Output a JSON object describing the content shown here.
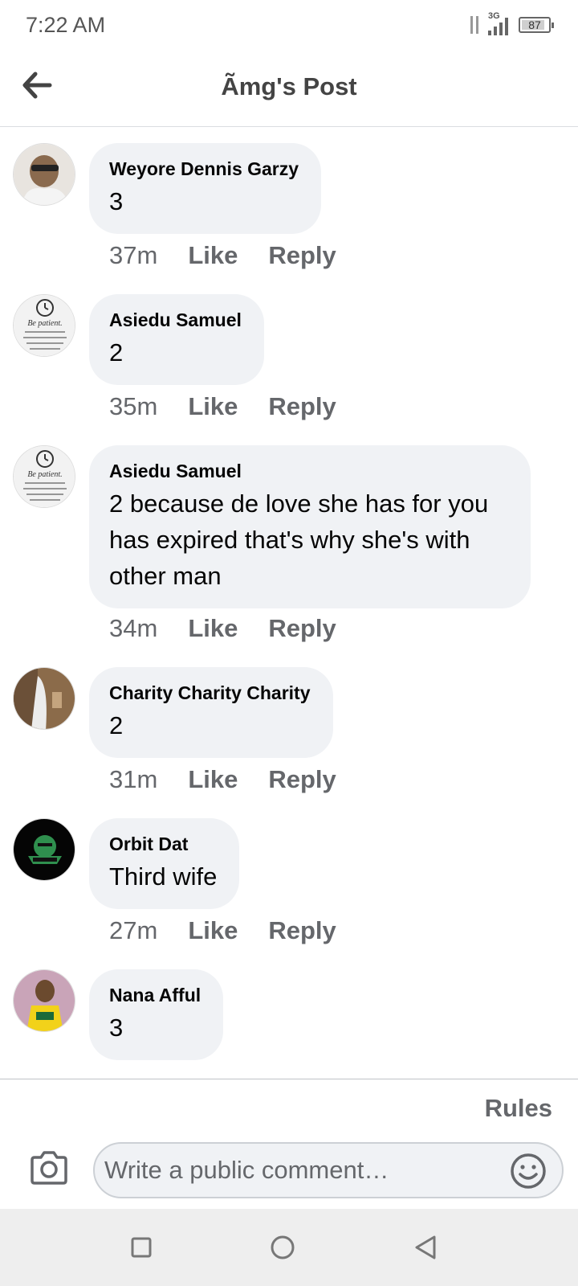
{
  "status_bar": {
    "time": "7:22 AM",
    "network": "3G",
    "battery": "87",
    "battery_level": 0.87
  },
  "header": {
    "title": "Ãmg's Post",
    "back_icon": "arrow-left-icon"
  },
  "comments": [
    {
      "author": "Weyore Dennis Garzy",
      "text": "3",
      "time": "37m",
      "like": "Like",
      "reply": "Reply"
    },
    {
      "author": "Asiedu Samuel",
      "text": "2",
      "time": "35m",
      "like": "Like",
      "reply": "Reply"
    },
    {
      "author": "Asiedu Samuel",
      "text": "2 because de love she has for you has expired that's why she's with other man",
      "time": "34m",
      "like": "Like",
      "reply": "Reply"
    },
    {
      "author": "Charity Charity Charity",
      "text": "2",
      "time": "31m",
      "like": "Like",
      "reply": "Reply"
    },
    {
      "author": "Orbit Dat",
      "text": "Third wife",
      "time": "27m",
      "like": "Like",
      "reply": "Reply"
    },
    {
      "author": "Nana Afful",
      "text": "3"
    }
  ],
  "composer": {
    "rules": "Rules",
    "placeholder": "Write a public comment…",
    "camera_icon": "camera-icon",
    "emoji_icon": "smiley-icon"
  },
  "nav_bar": {
    "recents_icon": "square-icon",
    "home_icon": "circle-icon",
    "back_icon": "triangle-back-icon"
  },
  "colors": {
    "bubble": "#f0f2f5",
    "meta_text": "#65676b",
    "title_text": "#444444"
  }
}
